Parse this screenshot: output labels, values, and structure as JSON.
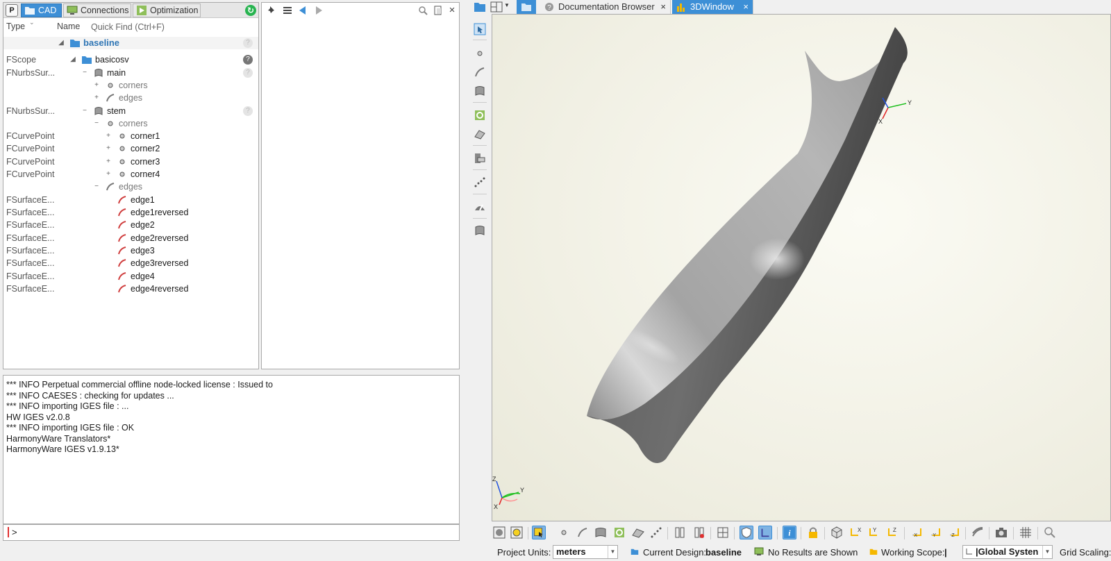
{
  "tree": {
    "tabs": [
      {
        "label": "CAD",
        "active": true,
        "icon": "folder-icon"
      },
      {
        "label": "Connections",
        "active": false,
        "icon": "monitor-icon"
      },
      {
        "label": "Optimization",
        "active": false,
        "icon": "play-icon"
      }
    ],
    "p_label": "P",
    "header": {
      "type": "Type",
      "name": "Name",
      "quick_find_placeholder": "Quick Find (Ctrl+F)"
    },
    "rows": [
      {
        "type": "",
        "name": "baseline",
        "icon": "folder-icon"
      },
      {
        "type": "FScope",
        "name": "basicosv",
        "icon": "folder-icon"
      },
      {
        "type": "FNurbsSur...",
        "name": "main",
        "icon": "surface-icon"
      },
      {
        "type": "",
        "name": "corners",
        "icon": "point-icon"
      },
      {
        "type": "",
        "name": "edges",
        "icon": "curve-icon"
      },
      {
        "type": "FNurbsSur...",
        "name": "stem",
        "icon": "surface-icon"
      },
      {
        "type": "",
        "name": "corners",
        "icon": "point-icon"
      },
      {
        "type": "FCurvePoint",
        "name": "corner1",
        "icon": "point-icon"
      },
      {
        "type": "FCurvePoint",
        "name": "corner2",
        "icon": "point-icon"
      },
      {
        "type": "FCurvePoint",
        "name": "corner3",
        "icon": "point-icon"
      },
      {
        "type": "FCurvePoint",
        "name": "corner4",
        "icon": "point-icon"
      },
      {
        "type": "",
        "name": "edges",
        "icon": "curve-icon"
      },
      {
        "type": "FSurfaceE...",
        "name": "edge1",
        "icon": "edge-curve-icon"
      },
      {
        "type": "FSurfaceE...",
        "name": "edge1reversed",
        "icon": "edge-curve-icon"
      },
      {
        "type": "FSurfaceE...",
        "name": "edge2",
        "icon": "edge-curve-icon"
      },
      {
        "type": "FSurfaceE...",
        "name": "edge2reversed",
        "icon": "edge-curve-icon"
      },
      {
        "type": "FSurfaceE...",
        "name": "edge3",
        "icon": "edge-curve-icon"
      },
      {
        "type": "FSurfaceE...",
        "name": "edge3reversed",
        "icon": "edge-curve-icon"
      },
      {
        "type": "FSurfaceE...",
        "name": "edge4",
        "icon": "edge-curve-icon"
      },
      {
        "type": "FSurfaceE...",
        "name": "edge4reversed",
        "icon": "edge-curve-icon"
      }
    ]
  },
  "console": {
    "lines": [
      "*** INFO Perpetual commercial offline node-locked license : Issued to",
      "*** INFO CAESES : checking for updates ...",
      "*** INFO importing IGES file : ...",
      "HW IGES v2.0.8",
      "*** INFO importing IGES file : OK",
      "HarmonyWare Translators*",
      "HarmonyWare IGES v1.9.13*"
    ],
    "prompt": ">"
  },
  "right_tabs": [
    {
      "label": "Documentation Browser",
      "active": false,
      "icon": "help-icon"
    },
    {
      "label": "3DWindow",
      "active": true,
      "icon": "chart-icon"
    }
  ],
  "viewport": {
    "axis_labels": {
      "x": "X",
      "y": "Y",
      "z": "Z"
    }
  },
  "status": {
    "project_units_label": "Project Units:",
    "project_units_value": "meters",
    "current_design_label": "Current Design:",
    "current_design_value": "baseline",
    "results": "No Results are Shown",
    "working_scope_label": "Working Scope:",
    "working_scope_value": "|",
    "coordinate_system": "|Global Systen",
    "grid_scaling_label": "Grid Scaling:"
  },
  "colors": {
    "accent": "#3d8fd6",
    "edge_red": "#d04040",
    "ok_green": "#28b450"
  }
}
